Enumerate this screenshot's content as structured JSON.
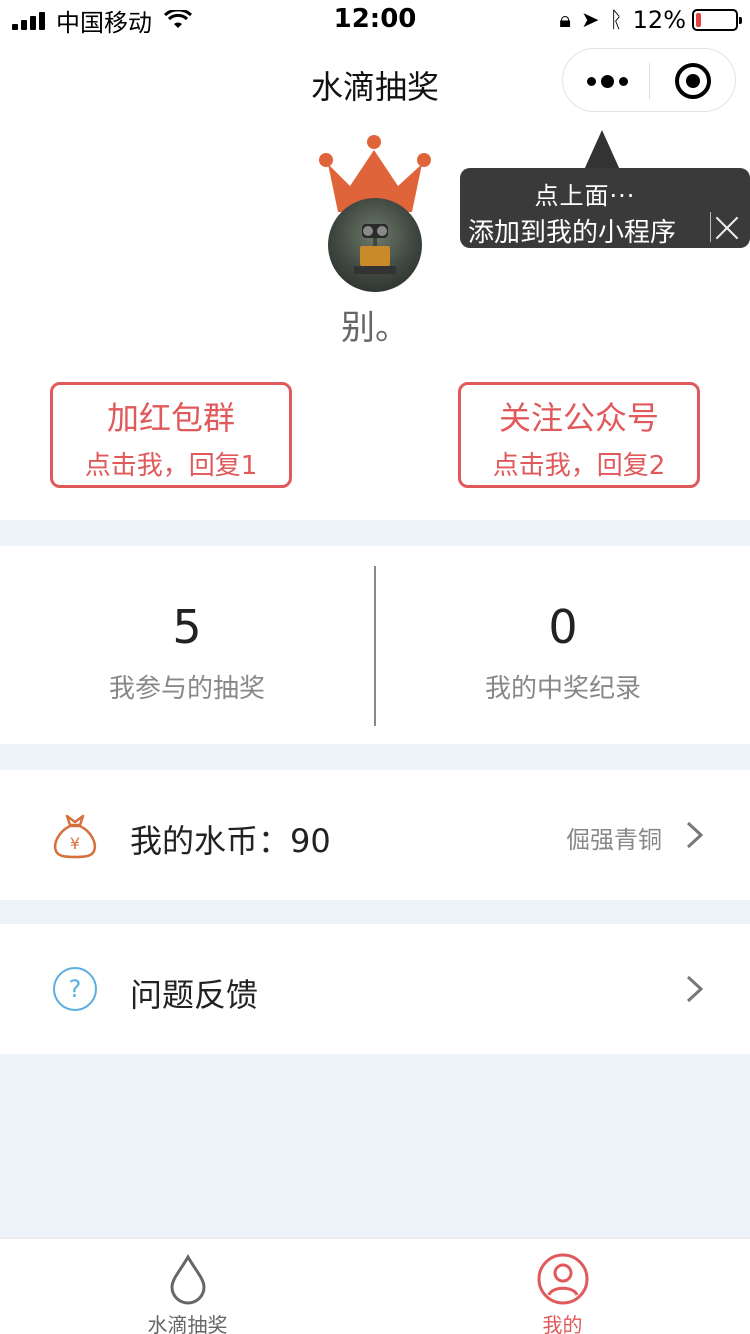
{
  "status_bar": {
    "carrier": "中国移动",
    "time": "12:00",
    "battery_percent": "12%",
    "battery_level": 0.12,
    "battery_color": "#e64340"
  },
  "nav": {
    "title": "水滴抽奖",
    "capsule_more_icon": "more-dots-icon",
    "capsule_close_icon": "target-circle-icon"
  },
  "tooltip": {
    "line1": "点上面···",
    "line2": "添加到我的小程序"
  },
  "profile": {
    "nickname": "别。",
    "crown_color": "#e0643a"
  },
  "actions": {
    "group": {
      "title": "加红包群",
      "subtitle": "点击我，回复1"
    },
    "follow": {
      "title": "关注公众号",
      "subtitle": "点击我，回复2"
    },
    "accent_color": "#e0595b"
  },
  "stats": {
    "participated": {
      "value": "5",
      "label": "我参与的抽奖"
    },
    "won": {
      "value": "0",
      "label": "我的中奖纪录"
    }
  },
  "rows": {
    "coins": {
      "label": "我的水币：90",
      "extra": "倔强青铜",
      "icon": "money-bag-icon"
    },
    "feedback": {
      "label": "问题反馈",
      "icon": "question-circle-icon"
    }
  },
  "tabs": {
    "home": {
      "label": "水滴抽奖",
      "icon": "water-drop-icon"
    },
    "mine": {
      "label": "我的",
      "icon": "user-circle-icon",
      "active": true
    }
  }
}
